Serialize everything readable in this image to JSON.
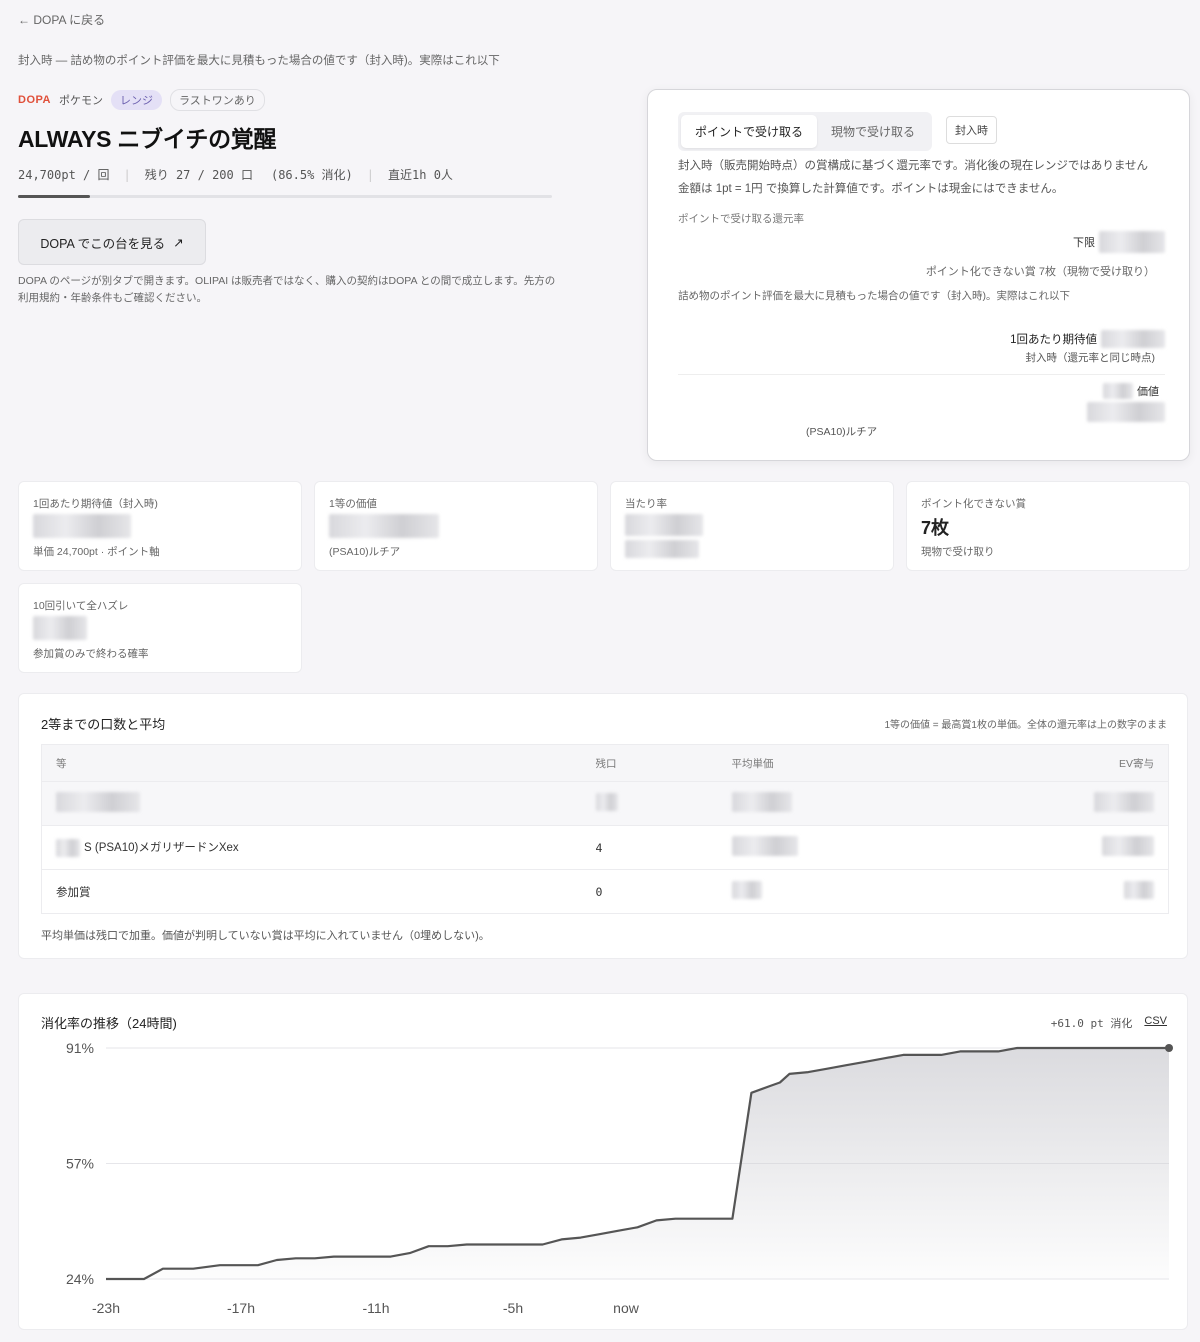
{
  "nav": {
    "back_label": "← DOPA に戻る"
  },
  "disclaimer_top": "封入時 — 詰め物のポイント評価を最大に見積もった場合の値です（封入時)。実際はこれ以下",
  "tags": {
    "source": "DOPA",
    "category": "ポケモン",
    "range": "レンジ",
    "last_one": "ラストワンあり"
  },
  "title": "ALWAYS ニブイチの覚醒",
  "stats": {
    "price": "24,700pt / 回",
    "remaining": "残り 27 / 200 口",
    "consumed": "(86.5% 消化)",
    "recent": "直近1h 0人",
    "progress": 0.135
  },
  "dopa_button": {
    "label": "DOPA でこの台を見る",
    "icon": "external-link-icon"
  },
  "dopa_note": "DOPA のページが別タブで開きます。OLIPAI は販売者ではなく、購入の契約はDOPA との間で成立します。先方の利用規約・年齢条件もご確認ください。",
  "panel": {
    "tabs": [
      "ポイントで受け取る",
      "現物で受け取る"
    ],
    "active_tab": 0,
    "sealed_label": "封入時",
    "desc1": "封入時（販売開始時点）の賞構成に基づく還元率です。消化後の現在レンジではありません",
    "desc2": "金額は 1pt = 1円 で換算した計算値です。ポイントは現金にはできません。",
    "section_label": "ポイントで受け取る還元率",
    "lower_label": "下限",
    "non_point_note": "ポイント化できない賞 7枚（現物で受け取り）",
    "disclaimer": "詰め物のポイント評価を最大に見積もった場合の値です（封入時)。実際はこれ以下",
    "ev_label": "1回あたり期待値",
    "ev_sub": "封入時（還元率と同じ時点)",
    "price_label": "価値",
    "card_name": "(PSA10)ルチア"
  },
  "metrics": [
    {
      "label": "1回あたり期待値（封入時)",
      "sub": "単価 24,700pt · ポイント軸"
    },
    {
      "label": "1等の価値",
      "sub": "(PSA10)ルチア"
    },
    {
      "label": "当たり率",
      "sub": ""
    },
    {
      "label": "ポイント化できない賞",
      "value": "7枚",
      "sub": "現物で受け取り"
    },
    {
      "label": "10回引いて全ハズレ",
      "sub": "参加賞のみで終わる確率"
    }
  ],
  "prize_table": {
    "title": "2等までの口数と平均",
    "note": "1等の価値 = 最高賞1枚の単価。全体の還元率は上の数字のまま",
    "columns": [
      "等",
      "残口",
      "平均単価",
      "EV寄与"
    ],
    "rows": [
      {
        "name": "",
        "remaining": "",
        "avg": "",
        "ev": ""
      },
      {
        "name": "S  (PSA10)メガリザードンXex",
        "remaining": "4",
        "avg": "",
        "ev": ""
      },
      {
        "name": "参加賞",
        "remaining": "0",
        "avg": "",
        "ev": ""
      }
    ],
    "footnote": "平均単価は残口で加重。価値が判明していない賞は平均に入れていません（0埋めしない)。"
  },
  "chart_header": {
    "title": "消化率の推移（24時間)",
    "delta": "+61.0 pt 消化",
    "csv_label": "CSV"
  },
  "chart_data": {
    "type": "area",
    "title": "消化率の推移（24時間)",
    "xlabel": "",
    "ylabel": "",
    "x_ticks": [
      "-23h",
      "-17h",
      "-11h",
      "-5h",
      "now"
    ],
    "y_ticks": [
      "91%",
      "57%",
      "24%"
    ],
    "ylim": [
      24,
      91
    ],
    "xlim": [
      -23,
      0
    ],
    "grid": true,
    "series": [
      {
        "x": [
          -23,
          -21,
          -20,
          -19,
          -18.4,
          -17,
          -16,
          -15,
          -14,
          -13,
          -12,
          -11,
          -10,
          -9,
          -8,
          -7,
          -6,
          -5,
          -4,
          -3,
          -2,
          -1,
          0,
          1,
          2,
          3,
          4,
          5,
          6,
          7,
          8,
          9,
          10,
          11,
          12,
          12.5,
          13,
          14,
          15,
          16,
          17,
          18,
          19,
          20,
          21,
          22,
          23,
          24,
          25,
          26,
          27,
          28,
          29,
          30,
          31,
          32,
          33
        ],
        "y": [
          24,
          24,
          27,
          27,
          27,
          28,
          28,
          28,
          29.5,
          30,
          30,
          30.5,
          30.5,
          30.5,
          30.5,
          31.5,
          33.5,
          33.5,
          34,
          34,
          34,
          34,
          34,
          35.5,
          36,
          37,
          38,
          39,
          41,
          41.5,
          41.5,
          41.5,
          41.5,
          78,
          80,
          81,
          83.5,
          84,
          85,
          86,
          87,
          88,
          89,
          89,
          89,
          90,
          90,
          90,
          91,
          91,
          91,
          91,
          91,
          91,
          91,
          91,
          91
        ]
      }
    ]
  }
}
